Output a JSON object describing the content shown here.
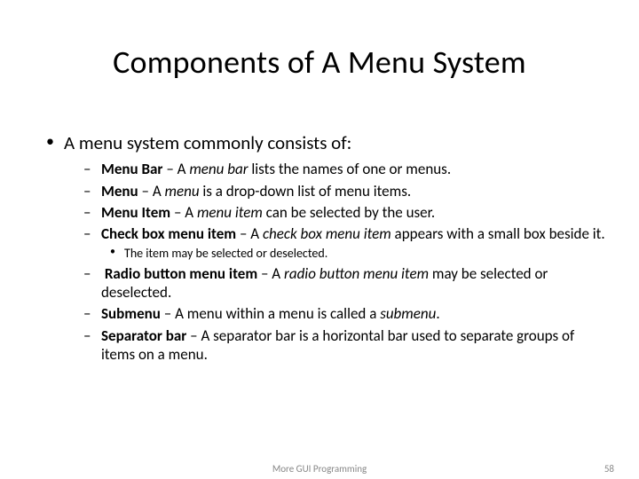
{
  "title": "Components of A Menu System",
  "intro": "A menu system commonly consists of:",
  "items": {
    "menubar": {
      "term": "Menu Bar",
      "sep": " – A ",
      "em": "menu bar",
      "rest": " lists the names of one or menus."
    },
    "menu": {
      "term": "Menu",
      "sep": " – A ",
      "em": "menu",
      "rest": " is a drop-down list of menu items."
    },
    "menuitem": {
      "term": "Menu Item",
      "sep": " – A ",
      "em": "menu item",
      "rest": " can be selected by the user."
    },
    "checkbox": {
      "term": "Check box menu item",
      "sep": " – A ",
      "em": "check box menu item",
      "rest": " appears with a small box beside it."
    },
    "checkbox_sub": "The item may be selected or deselected.",
    "radio": {
      "term": "Radio button menu item",
      "sep": " – A ",
      "em": "radio button menu item",
      "rest": " may be selected or deselected."
    },
    "submenu": {
      "term": "Submenu",
      "sep": " – A menu within a menu is called a ",
      "em": "submenu",
      "rest": "."
    },
    "separator": {
      "term": "Separator bar",
      "sep": " – A separator bar is a horizontal bar used to separate groups of items on a menu.",
      "em": "",
      "rest": ""
    }
  },
  "footer": {
    "center": "More GUI Programming",
    "page": "58"
  }
}
